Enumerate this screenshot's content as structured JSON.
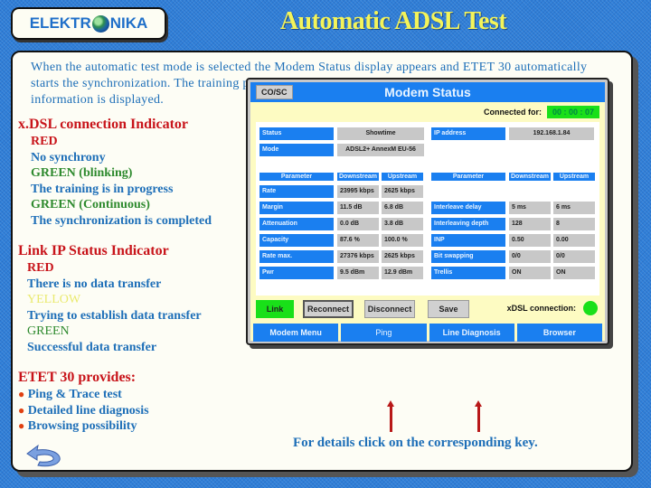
{
  "header": {
    "logo_left": "ELEKTR",
    "logo_right": "NIKA",
    "title": "Automatic ADSL Test"
  },
  "intro": "When the automatic test mode is selected the Modem Status display appears and ETET 30 automatically starts the synchronization. The training process takes a while. During this time the actual modem status  information is displayed.",
  "xdsl_indicator": {
    "title": "x.DSL connection Indicator",
    "lines": [
      {
        "text": "RED",
        "color": "red"
      },
      {
        "text": "No synchrony",
        "color": "blue"
      },
      {
        "text": "GREEN (blinking)",
        "color": "green"
      },
      {
        "text": "The training is in progress",
        "color": "blue"
      },
      {
        "text": "GREEN (Continuous)",
        "color": "green"
      },
      {
        "text": "The synchronization is completed",
        "color": "blue"
      }
    ]
  },
  "link_indicator": {
    "title": "Link IP Status Indicator",
    "lines": [
      {
        "text": "RED",
        "color": "red"
      },
      {
        "text": "There is no data transfer",
        "color": "blue"
      },
      {
        "text": "YELLOW",
        "color": "yellow"
      },
      {
        "text": "Trying to establish data transfer",
        "color": "blue"
      },
      {
        "text": "GREEN",
        "color": "green"
      },
      {
        "text": "Successful data transfer",
        "color": "blue"
      }
    ]
  },
  "provides": {
    "title": "ETET 30 provides:",
    "items": [
      "Ping & Trace test",
      "Detailed line diagnosis",
      "Browsing possibility"
    ]
  },
  "footer_note": "For details click on the corresponding key.",
  "modem": {
    "title": "Modem Status",
    "coc_button": "CO/SC",
    "connected_label": "Connected for:",
    "connected_time": "00 : 00 : 07",
    "status_label": "Status",
    "status_value": "Showtime",
    "ip_label": "IP address",
    "ip_value": "192.168.1.84",
    "mode_label": "Mode",
    "mode_value": "ADSL2+ AnnexM EU-56",
    "col_headers": [
      "Parameter",
      "Downstream",
      "Upstream"
    ],
    "left_rows": [
      {
        "param": "Rate",
        "down": "23995 kbps",
        "up": "2625 kbps"
      },
      {
        "param": "Margin",
        "down": "11.5 dB",
        "up": "6.8 dB"
      },
      {
        "param": "Attenuation",
        "down": "0.0 dB",
        "up": "3.8 dB"
      },
      {
        "param": "Capacity",
        "down": "87.6 %",
        "up": "100.0 %"
      },
      {
        "param": "Rate max.",
        "down": "27376 kbps",
        "up": "2625 kbps"
      },
      {
        "param": "Pwr",
        "down": "9.5 dBm",
        "up": "12.9 dBm"
      }
    ],
    "right_rows": [
      {
        "param": "Interleave delay",
        "down": "5 ms",
        "up": "6 ms"
      },
      {
        "param": "Interleaving depth",
        "down": "128",
        "up": "8"
      },
      {
        "param": "INP",
        "down": "0.50",
        "up": "0.00"
      },
      {
        "param": "Bit swapping",
        "down": "0/0",
        "up": "0/0"
      },
      {
        "param": "Trellis",
        "down": "ON",
        "up": "ON"
      }
    ],
    "buttons": {
      "link": "Link",
      "reconnect": "Reconnect",
      "disconnect": "Disconnect",
      "save": "Save"
    },
    "xdsl_connection_label": "xDSL connection:",
    "nav": [
      "Modem Menu",
      "Ping",
      "Line Diagnosis",
      "Browser"
    ]
  }
}
